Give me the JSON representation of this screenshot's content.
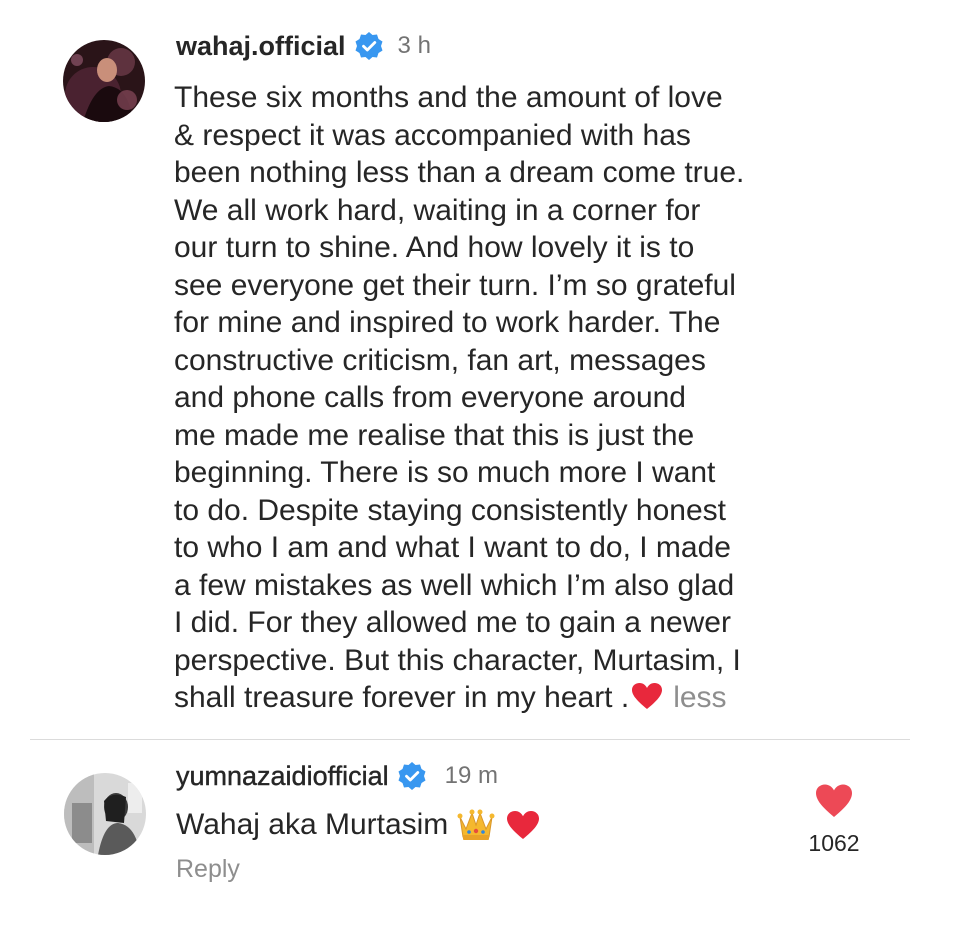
{
  "post": {
    "username": "wahaj.official",
    "timestamp": "3 h",
    "caption_lines": [
      "These six months and the amount of love",
      "& respect it was accompanied with has",
      "been nothing less than a dream come true.",
      "We all work hard, waiting in a corner for",
      "our turn to shine. And how lovely it is to",
      "see everyone get their turn. I’m so grateful",
      "for mine and inspired to work harder. The",
      "constructive criticism, fan art, messages",
      "and phone calls from everyone around",
      "me made me realise that this is just the",
      "beginning. There is so much more I want",
      "to do. Despite staying consistently honest",
      "to who I am and what I want to do, I made",
      "a few mistakes as well which I’m also glad",
      "I did. For they allowed me to gain a newer",
      "perspective. But this character, Murtasim, I",
      "shall treasure forever in my heart ."
    ],
    "less_label": "less"
  },
  "comment": {
    "username": "yumnazaidiofficial",
    "timestamp": "19 m",
    "text": "Wahaj aka Murtasim",
    "reply_label": "Reply",
    "like_count": "1062"
  },
  "icons": {
    "verified": "verified-badge-icon",
    "heart": "heart-icon",
    "crown": "crown-emoji-icon"
  },
  "colors": {
    "verified_blue": "#3897f0",
    "heart_red": "#ed4956",
    "muted_text": "#8e8e8e"
  }
}
